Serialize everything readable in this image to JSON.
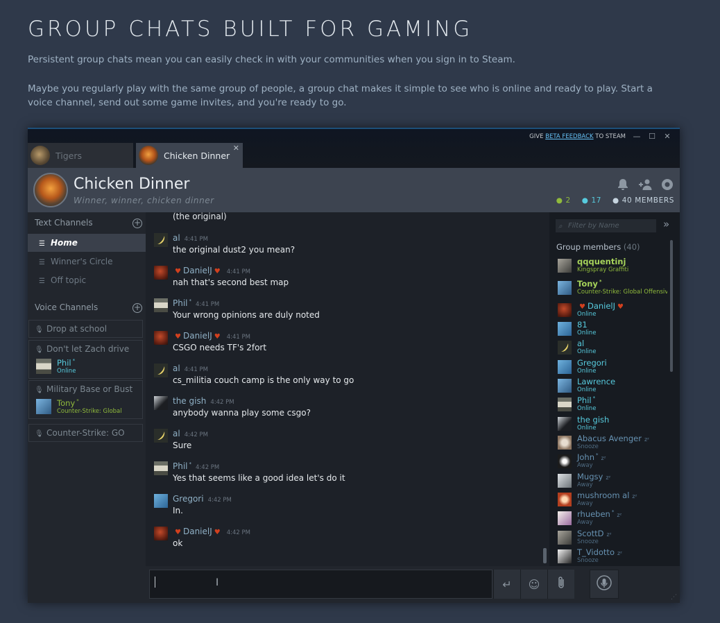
{
  "hero": {
    "title": "GROUP CHATS BUILT FOR GAMING",
    "p1": "Persistent group chats mean you can easily check in with your communities when you sign in to Steam.",
    "p2": "Maybe you regularly play with the same group of people, a group chat makes it simple to see who is online and ready to play. Start a voice channel, send out some game invites, and you're ready to go."
  },
  "titlebar": {
    "give": "GIVE",
    "beta_feedback": "BETA FEEDBACK",
    "to_steam": "TO STEAM",
    "minimize": "—",
    "maximize": "☐",
    "close": "✕"
  },
  "tabs": [
    {
      "label": "Tigers"
    },
    {
      "label": "Chicken Dinner",
      "close": "✕"
    }
  ],
  "header": {
    "title": "Chicken Dinner",
    "subtitle": "Winner, winner, chicken dinner",
    "counts": {
      "ingame": "2",
      "online": "17",
      "members": "40 MEMBERS"
    },
    "colors": {
      "ingame": "#90ba3c",
      "online": "#57cbde",
      "members": "#c6d4df"
    }
  },
  "text_channels": {
    "header": "Text Channels",
    "items": [
      "Home",
      "Winner's Circle",
      "Off topic"
    ]
  },
  "voice_channels": {
    "header": "Voice Channels",
    "rooms": [
      {
        "name": "Drop at school"
      },
      {
        "name": "Don't let Zach drive",
        "member": {
          "name": "Phil",
          "status": "Online"
        }
      },
      {
        "name": "Military Base or Bust",
        "member": {
          "name": "Tony",
          "status": "Counter-Strike: Global"
        }
      },
      {
        "name": "Counter-Strike: GO"
      }
    ]
  },
  "messages": [
    {
      "name": "",
      "time": "",
      "text": "(the original)"
    },
    {
      "name": "al",
      "time": "4:41 PM",
      "text": "the original dust2 you mean?"
    },
    {
      "name": "DanielJ",
      "time": "4:41 PM",
      "text": "nah that's second best map"
    },
    {
      "name": "Phil",
      "time": "4:41 PM",
      "text": "Your wrong opinions are duly noted"
    },
    {
      "name": "DanielJ",
      "time": "4:41 PM",
      "text": "CSGO needs TF's 2fort"
    },
    {
      "name": "al",
      "time": "4:41 PM",
      "text": "cs_militia couch camp is the only way to go"
    },
    {
      "name": "the gish",
      "time": "4:42 PM",
      "text": "anybody wanna play some csgo?"
    },
    {
      "name": "al",
      "time": "4:42 PM",
      "text": "Sure"
    },
    {
      "name": "Phil",
      "time": "4:42 PM",
      "text": "Yes that seems like a good idea let's do it"
    },
    {
      "name": "Gregori",
      "time": "4:42 PM",
      "text": "In."
    },
    {
      "name": "DanielJ",
      "time": "4:42 PM",
      "text": "ok"
    }
  ],
  "members": {
    "filter_placeholder": "Filter by Name",
    "header": "Group members",
    "count": "(40)",
    "list": [
      {
        "name": "qqquentinj",
        "status": "Kingspray Graffiti"
      },
      {
        "name": "Tony",
        "status": "Counter-Strike: Global Offensive"
      },
      {
        "name": "DanielJ",
        "status": "Online"
      },
      {
        "name": "81",
        "status": "Online"
      },
      {
        "name": "al",
        "status": "Online"
      },
      {
        "name": "Gregori",
        "status": "Online"
      },
      {
        "name": "Lawrence",
        "status": "Online"
      },
      {
        "name": "Phil",
        "status": "Online"
      },
      {
        "name": "the gish",
        "status": "Online"
      },
      {
        "name": "Abacus Avenger",
        "status": "Snooze"
      },
      {
        "name": "John",
        "status": "Away"
      },
      {
        "name": "Mugsy",
        "status": "Away"
      },
      {
        "name": "mushroom al",
        "status": "Away"
      },
      {
        "name": "rhueben",
        "status": "Away"
      },
      {
        "name": "ScottD",
        "status": "Snooze"
      },
      {
        "name": "T_Vidotto",
        "status": "Snooze"
      }
    ]
  },
  "composer": {
    "send_icon": "↵",
    "emoji_icon": "☺",
    "attach_icon": "attach-icon"
  },
  "colors": {
    "ingame": "#90ba3c",
    "online": "#57cbde",
    "away": "#6792b2",
    "accent": "#66c0f4"
  }
}
